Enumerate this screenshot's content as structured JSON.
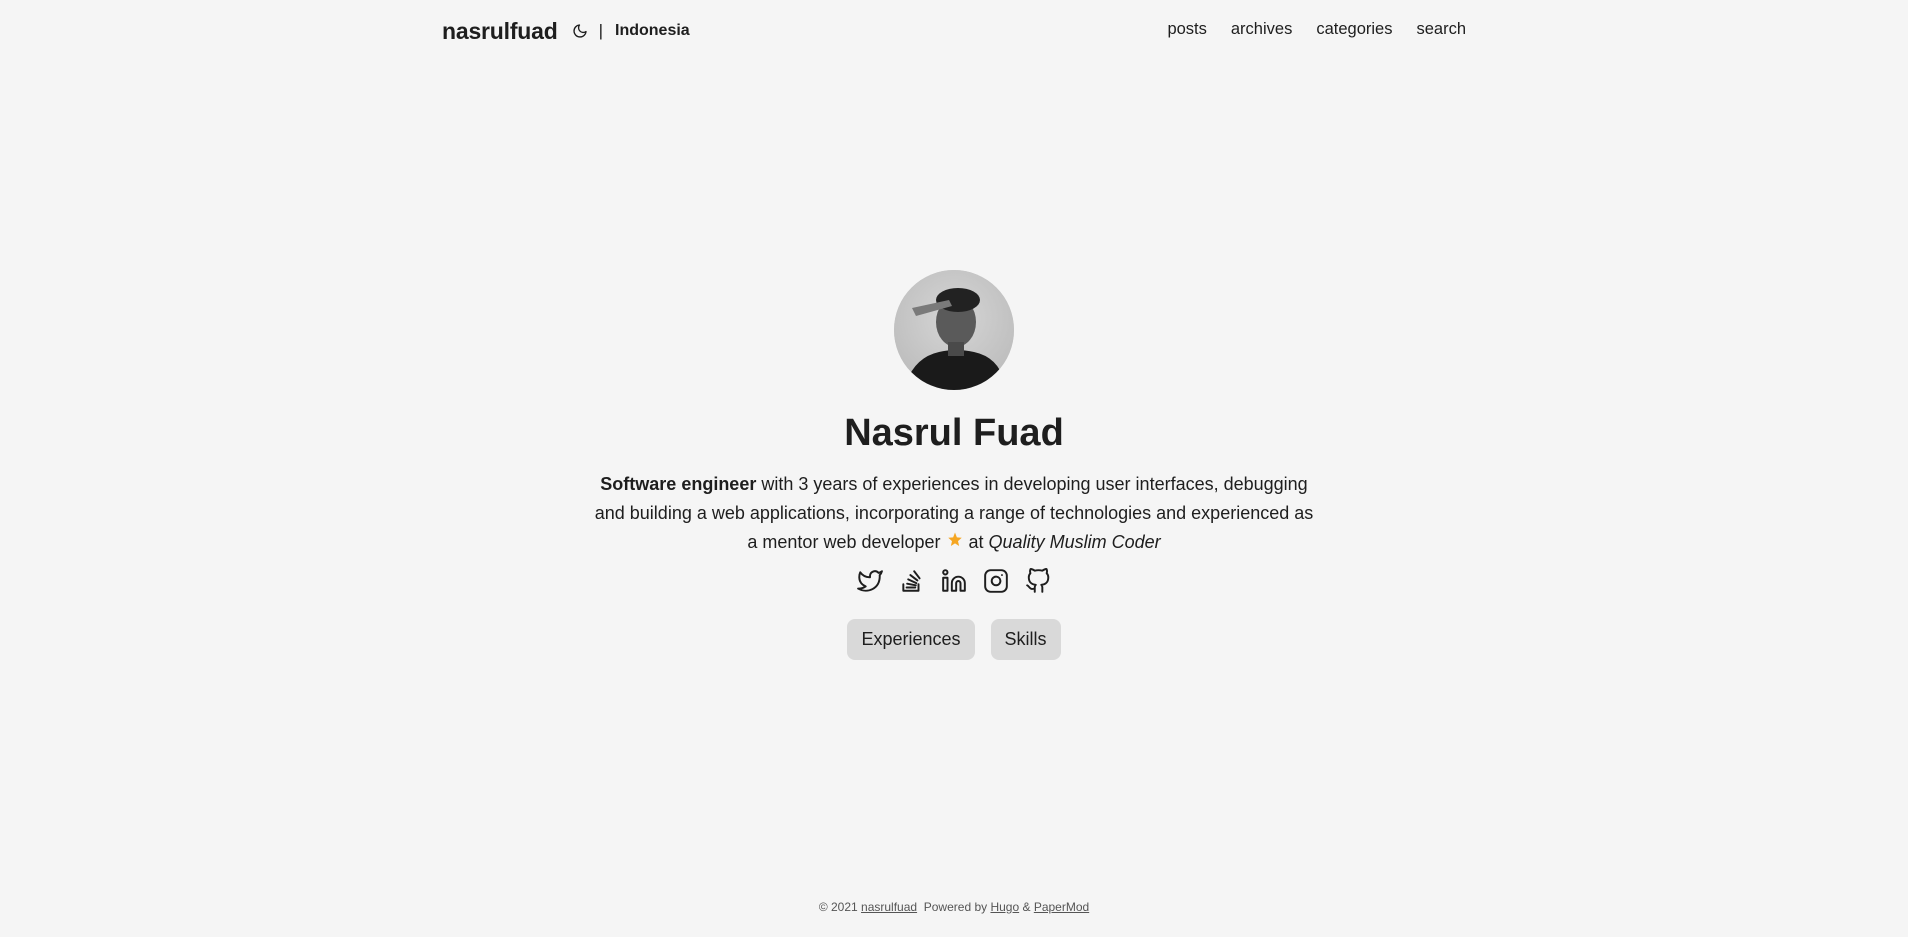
{
  "header": {
    "logo": "nasrulfuad",
    "theme_toggle_icon": "moon-icon",
    "separator": "|",
    "language": "Indonesia",
    "nav": [
      "posts",
      "archives",
      "categories",
      "search"
    ]
  },
  "profile": {
    "avatar_alt": "avatar",
    "name": "Nasrul Fuad",
    "bio": {
      "strong": "Software engineer",
      "text1": " with 3 years of experiences in developing user interfaces, debugging and building a web applications, incorporating a range of technologies and experienced as a mentor web developer ",
      "text2": " at ",
      "emphasis": "Quality Muslim Coder"
    },
    "socials": [
      "twitter-icon",
      "stackoverflow-icon",
      "linkedin-icon",
      "instagram-icon",
      "github-icon"
    ],
    "buttons": [
      "Experiences",
      "Skills"
    ]
  },
  "footer": {
    "copyright": "© 2021 ",
    "site": "nasrulfuad",
    "powered": "Powered by ",
    "hugo": "Hugo",
    "amp": " & ",
    "papermod": "PaperMod"
  },
  "colors": {
    "background": "#f5f5f5",
    "text": "#1e1e1e",
    "button": "#d9d9d9",
    "star": "#f5a623"
  }
}
